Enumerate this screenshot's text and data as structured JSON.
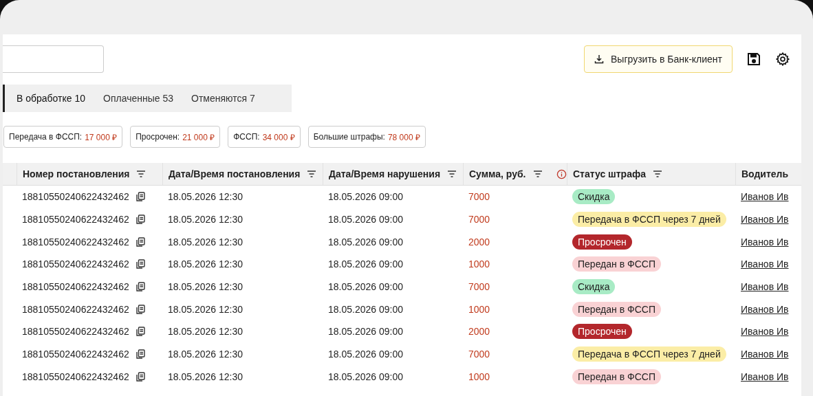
{
  "export_button": {
    "label": "Выгрузить в Банк-клиент"
  },
  "tabs": [
    {
      "label": "В обработке 10",
      "selected": true
    },
    {
      "label": "Оплаченные 53",
      "selected": false
    },
    {
      "label": "Отменяются 7",
      "selected": false
    }
  ],
  "summary_chips": [
    {
      "label": "Передача в ФССП:",
      "amount": "17 000 ₽"
    },
    {
      "label": "Просрочен:",
      "amount": "21 000 ₽"
    },
    {
      "label": "ФССП:",
      "amount": "34 000 ₽"
    },
    {
      "label": "Большие штрафы:",
      "amount": "78 000 ₽"
    }
  ],
  "table": {
    "columns": [
      {
        "label": "Номер постановления",
        "filter": true
      },
      {
        "label": "Дата/Время постановления",
        "filter": true
      },
      {
        "label": "Дата/Время нарушения",
        "filter": true
      },
      {
        "label": "Сумма, руб.",
        "filter": true,
        "info": true
      },
      {
        "label": "Статус штрафа",
        "filter": true
      },
      {
        "label": "Водитель",
        "filter": false
      }
    ],
    "rows": [
      {
        "number": "18810550240622432462",
        "issued": "18.05.2026 12:30",
        "violation": "18.05.2026 09:00",
        "amount": "7000",
        "status": {
          "label": "Скидка",
          "kind": "discount"
        },
        "driver": "Иванов Ив"
      },
      {
        "number": "18810550240622432462",
        "issued": "18.05.2026 12:30",
        "violation": "18.05.2026 09:00",
        "amount": "7000",
        "status": {
          "label": "Передача в ФССП через 7 дней",
          "kind": "pending"
        },
        "driver": "Иванов Ив"
      },
      {
        "number": "18810550240622432462",
        "issued": "18.05.2026 12:30",
        "violation": "18.05.2026 09:00",
        "amount": "2000",
        "status": {
          "label": "Просрочен",
          "kind": "overdue"
        },
        "driver": "Иванов Ив"
      },
      {
        "number": "18810550240622432462",
        "issued": "18.05.2026 12:30",
        "violation": "18.05.2026 09:00",
        "amount": "1000",
        "status": {
          "label": "Передан в ФССП",
          "kind": "transferred"
        },
        "driver": "Иванов Ив"
      },
      {
        "number": "18810550240622432462",
        "issued": "18.05.2026 12:30",
        "violation": "18.05.2026 09:00",
        "amount": "7000",
        "status": {
          "label": "Скидка",
          "kind": "discount"
        },
        "driver": "Иванов Ив"
      },
      {
        "number": "18810550240622432462",
        "issued": "18.05.2026 12:30",
        "violation": "18.05.2026 09:00",
        "amount": "1000",
        "status": {
          "label": "Передан в ФССП",
          "kind": "transferred"
        },
        "driver": "Иванов Ив"
      },
      {
        "number": "18810550240622432462",
        "issued": "18.05.2026 12:30",
        "violation": "18.05.2026 09:00",
        "amount": "2000",
        "status": {
          "label": "Просрочен",
          "kind": "overdue"
        },
        "driver": "Иванов Ив"
      },
      {
        "number": "18810550240622432462",
        "issued": "18.05.2026 12:30",
        "violation": "18.05.2026 09:00",
        "amount": "7000",
        "status": {
          "label": "Передача в ФССП через 7 дней",
          "kind": "pending"
        },
        "driver": "Иванов Ив"
      },
      {
        "number": "18810550240622432462",
        "issued": "18.05.2026 12:30",
        "violation": "18.05.2026 09:00",
        "amount": "1000",
        "status": {
          "label": "Передан в ФССП",
          "kind": "transferred"
        },
        "driver": "Иванов Ив"
      }
    ]
  }
}
